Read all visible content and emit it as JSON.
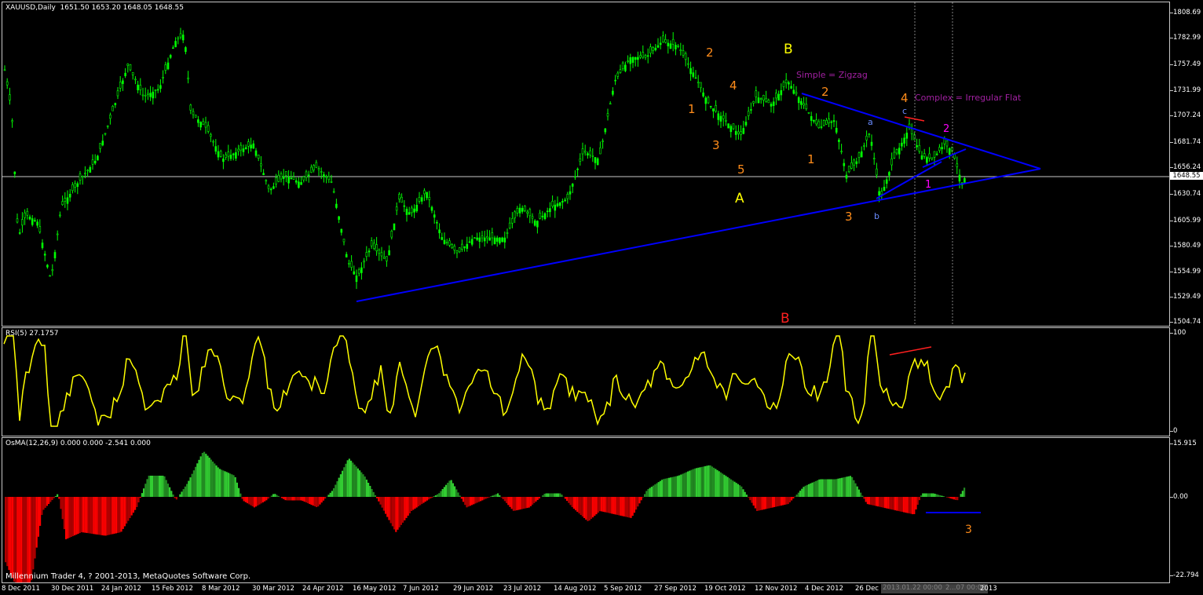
{
  "symbol_header": "XAUUSD,Daily  1651.50 1653.20 1648.05 1648.55",
  "current_price": "1648.55",
  "price_axis": [
    "1808.69",
    "1782.99",
    "1757.49",
    "1731.99",
    "1707.24",
    "1681.74",
    "1656.24",
    "1630.74",
    "1605.99",
    "1580.49",
    "1554.99",
    "1529.49",
    "1504.74"
  ],
  "rsi": {
    "title": "RSI(5) 27.1757",
    "axis": [
      "100",
      "0"
    ]
  },
  "osma": {
    "title": "OsMA(12,26,9) 0.000 0.000 -2.541 0.000",
    "axis": [
      "15.915",
      "0.00",
      "-22.794"
    ]
  },
  "copyright": "Millennium Trader 4, ? 2001-2013, MetaQuotes Software Corp.",
  "time_axis": [
    "8 Dec 2011",
    "30 Dec 2011",
    "24 Jan 2012",
    "15 Feb 2012",
    "8 Mar 2012",
    "30 Mar 2012",
    "24 Apr 2012",
    "16 May 2012",
    "7 Jun 2012",
    "29 Jun 2012",
    "23 Jul 2012",
    "14 Aug 2012",
    "5 Sep 2012",
    "27 Sep 2012",
    "19 Oct 2012",
    "12 Nov 2012",
    "4 Dec 2012",
    "26 Dec 2012"
  ],
  "time_highlight": "2013.01.22 00:00",
  "time_highlight2": "2...07 00:00",
  "time_end": "2013",
  "wave_labels": {
    "big_B": "B",
    "big_A": "A",
    "big_B_red": "B",
    "simple": "Simple = Zigzag",
    "complex": "Complex = Irregular Flat",
    "o1a": "1",
    "o2a": "2",
    "o3a": "3",
    "o4a": "4",
    "o5a": "5",
    "o1b": "1",
    "o2b": "2",
    "o3b": "3",
    "o4b": "4",
    "a": "a",
    "b": "b",
    "c": "c",
    "m1": "1",
    "m2": "2",
    "osma3": "3"
  },
  "colors": {
    "bull": "#00ff00",
    "rsi": "#ffff00",
    "osma_up": "#32cd32",
    "osma_down": "#ff0000",
    "trendline": "#0000ff",
    "wave_orange": "#ff8c1a",
    "wave_yellow": "#ffff00",
    "wave_purple": "#a020a0",
    "wave_magenta": "#ff00ff"
  }
}
